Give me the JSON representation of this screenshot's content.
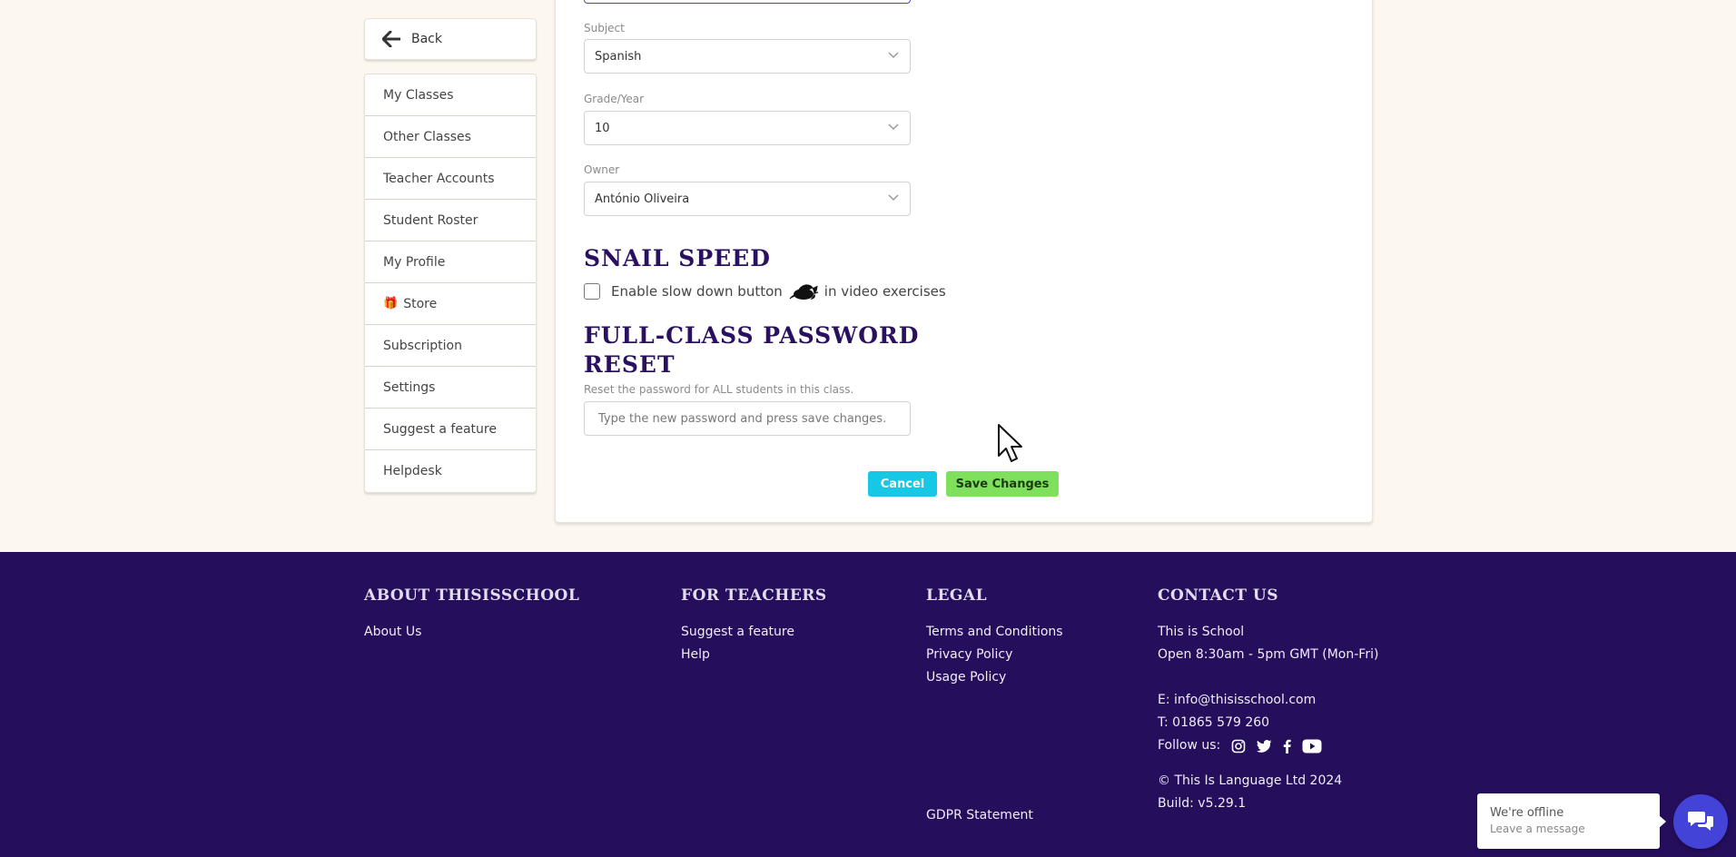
{
  "sidebar": {
    "back_label": "Back",
    "items": [
      {
        "label": "My Classes"
      },
      {
        "label": "Other Classes"
      },
      {
        "label": "Teacher Accounts"
      },
      {
        "label": "Student Roster"
      },
      {
        "label": "My Profile"
      },
      {
        "label": "Store",
        "icon": "gift-icon"
      },
      {
        "label": "Subscription"
      },
      {
        "label": "Settings"
      },
      {
        "label": "Suggest a feature"
      },
      {
        "label": "Helpdesk"
      }
    ]
  },
  "form": {
    "subject": {
      "label": "Subject",
      "value": "Spanish"
    },
    "grade": {
      "label": "Grade/Year",
      "value": "10"
    },
    "owner": {
      "label": "Owner",
      "value": "António Oliveira"
    },
    "snail_speed": {
      "heading": "Snail Speed",
      "checkbox_text_before": "Enable slow down button",
      "checkbox_text_after": "in video exercises",
      "checked": false
    },
    "password_reset": {
      "heading": "Full-Class Password Reset",
      "description": "Reset the password for ALL students in this class.",
      "placeholder": "Type the new password and press save changes.",
      "value": ""
    },
    "cancel_label": "Cancel",
    "save_label": "Save Changes"
  },
  "footer": {
    "about": {
      "heading": "About ThisIsSchool",
      "links": [
        "About Us"
      ]
    },
    "teachers": {
      "heading": "For Teachers",
      "links": [
        "Suggest a feature",
        "Help"
      ]
    },
    "legal": {
      "heading": "Legal",
      "links": [
        "Terms and Conditions",
        "Privacy Policy",
        "Usage Policy"
      ],
      "gdpr": "GDPR Statement"
    },
    "contact": {
      "heading": "Contact Us",
      "name": "This is School",
      "hours": "Open 8:30am - 5pm GMT (Mon-Fri)",
      "email": "E: info@thisisschool.com",
      "phone": "T: 01865 579 260",
      "follow": "Follow us:",
      "copyright": "© This Is Language Ltd 2024",
      "build": "Build: v5.29.1"
    }
  },
  "chat": {
    "title": "We're offline",
    "subtitle": "Leave a message"
  },
  "colors": {
    "heading": "#2a1160",
    "footer_bg": "#250e5c",
    "cancel": "#17c8e6",
    "save": "#7ee05c",
    "chat": "#4343d8"
  }
}
